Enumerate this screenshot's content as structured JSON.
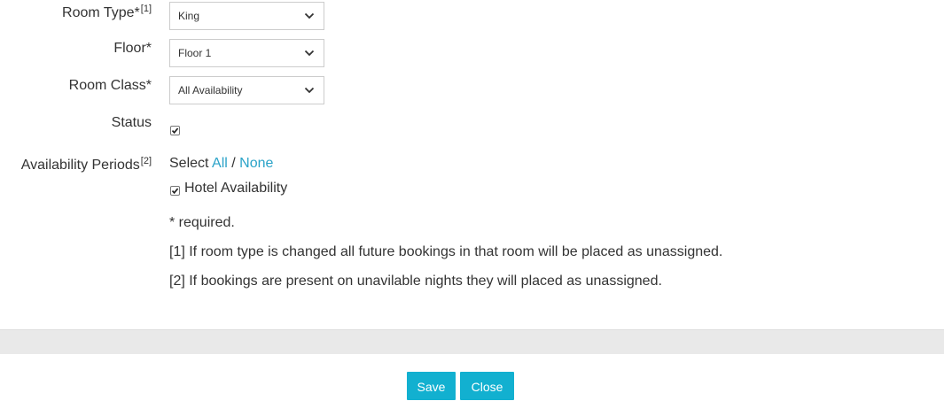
{
  "form": {
    "room_type": {
      "label": "Room Type*",
      "ref": "[1]",
      "value": "King"
    },
    "floor": {
      "label": "Floor*",
      "value": "Floor 1"
    },
    "room_class": {
      "label": "Room Class*",
      "value": "All Availability"
    },
    "status": {
      "label": "Status",
      "checked": true
    },
    "availability_periods": {
      "label": "Availability Periods",
      "ref": "[2]",
      "select_prefix": "Select",
      "select_all": "All",
      "separator": "/",
      "select_none": "None",
      "items": [
        {
          "label": "Hotel Availability",
          "checked": true
        }
      ]
    }
  },
  "notes": {
    "required": "* required.",
    "note1": "[1] If room type is changed all future bookings in that room will be placed as unassigned.",
    "note2": "[2] If bookings are present on unavilable nights they will placed as unassigned."
  },
  "footer": {
    "save_label": "Save",
    "close_label": "Close"
  },
  "colors": {
    "link": "#2ba3c8",
    "button": "#12b0d0",
    "footer_bar": "#e9e9e9"
  },
  "icons": {
    "dropdown": "chevron-down-icon",
    "check": "checkmark-icon"
  }
}
